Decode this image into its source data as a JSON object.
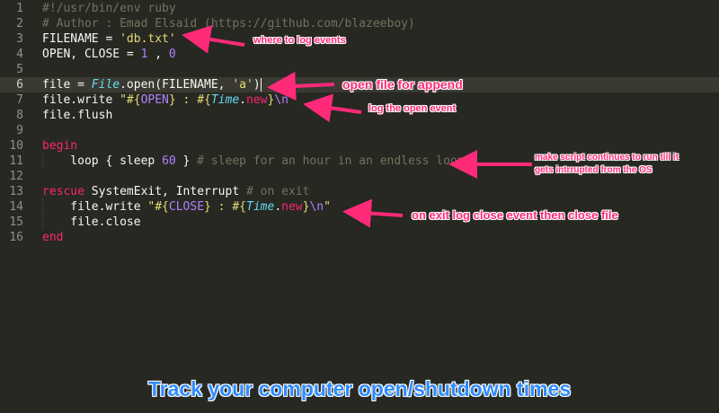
{
  "editor": {
    "active_line": 6,
    "lines": [
      {
        "n": "1",
        "tokens": [
          {
            "t": "#!/usr/bin/env ruby",
            "c": "c"
          }
        ]
      },
      {
        "n": "2",
        "tokens": [
          {
            "t": "# Author : Emad Elsaid (https://github.com/blazeeboy)",
            "c": "c"
          }
        ]
      },
      {
        "n": "3",
        "tokens": [
          {
            "t": "FILENAME = ",
            "c": ""
          },
          {
            "t": "'db.txt'",
            "c": "s"
          }
        ]
      },
      {
        "n": "4",
        "tokens": [
          {
            "t": "OPEN, CLOSE = ",
            "c": ""
          },
          {
            "t": "1",
            "c": "n"
          },
          {
            "t": " , ",
            "c": ""
          },
          {
            "t": "0",
            "c": "n"
          }
        ]
      },
      {
        "n": "5",
        "tokens": []
      },
      {
        "n": "6",
        "tokens": [
          {
            "t": "file = ",
            "c": ""
          },
          {
            "t": "File",
            "c": "cls"
          },
          {
            "t": ".open(FILENAME, ",
            "c": ""
          },
          {
            "t": "'a'",
            "c": "s"
          },
          {
            "t": ")",
            "c": ""
          }
        ]
      },
      {
        "n": "7",
        "tokens": [
          {
            "t": "file.write ",
            "c": ""
          },
          {
            "t": "\"#{",
            "c": "s"
          },
          {
            "t": "OPEN",
            "c": "i"
          },
          {
            "t": "} : #{",
            "c": "s"
          },
          {
            "t": "Time",
            "c": "cls"
          },
          {
            "t": ".",
            "c": ""
          },
          {
            "t": "new",
            "c": "k"
          },
          {
            "t": "}",
            "c": "s"
          },
          {
            "t": "\\n",
            "c": "sp"
          },
          {
            "t": "\"",
            "c": "s"
          }
        ]
      },
      {
        "n": "8",
        "tokens": [
          {
            "t": "file.flush",
            "c": ""
          }
        ]
      },
      {
        "n": "9",
        "tokens": []
      },
      {
        "n": "10",
        "tokens": [
          {
            "t": "begin",
            "c": "k"
          }
        ]
      },
      {
        "n": "11",
        "tokens": [
          {
            "t": "    loop { sleep ",
            "c": ""
          },
          {
            "t": "60",
            "c": "n"
          },
          {
            "t": " } ",
            "c": ""
          },
          {
            "t": "# sleep for an hour in an endless loop",
            "c": "c"
          }
        ]
      },
      {
        "n": "12",
        "tokens": []
      },
      {
        "n": "13",
        "tokens": [
          {
            "t": "rescue",
            "c": "k"
          },
          {
            "t": " SystemExit, Interrupt ",
            "c": ""
          },
          {
            "t": "# on exit",
            "c": "c"
          }
        ]
      },
      {
        "n": "14",
        "tokens": [
          {
            "t": "    file.write ",
            "c": ""
          },
          {
            "t": "\"#{",
            "c": "s"
          },
          {
            "t": "CLOSE",
            "c": "i"
          },
          {
            "t": "} : #{",
            "c": "s"
          },
          {
            "t": "Time",
            "c": "cls"
          },
          {
            "t": ".",
            "c": ""
          },
          {
            "t": "new",
            "c": "k"
          },
          {
            "t": "}",
            "c": "s"
          },
          {
            "t": "\\n",
            "c": "sp"
          },
          {
            "t": "\"",
            "c": "s"
          }
        ]
      },
      {
        "n": "15",
        "tokens": [
          {
            "t": "    file.close",
            "c": ""
          }
        ]
      },
      {
        "n": "16",
        "tokens": [
          {
            "t": "end",
            "c": "k"
          }
        ]
      }
    ]
  },
  "annotations": {
    "log_events": "where to log events",
    "open_append": "open file for append",
    "log_open": "log the open event",
    "loop_line1": "make script continues to run till it",
    "loop_line2": "gets intrrupted from the OS",
    "on_exit": "on exit log close event then close file"
  },
  "caption": "Track your computer open/shutdown times",
  "colors": {
    "background": "#272822",
    "annotation": "#ff2a78",
    "caption": "#2f8cff"
  }
}
